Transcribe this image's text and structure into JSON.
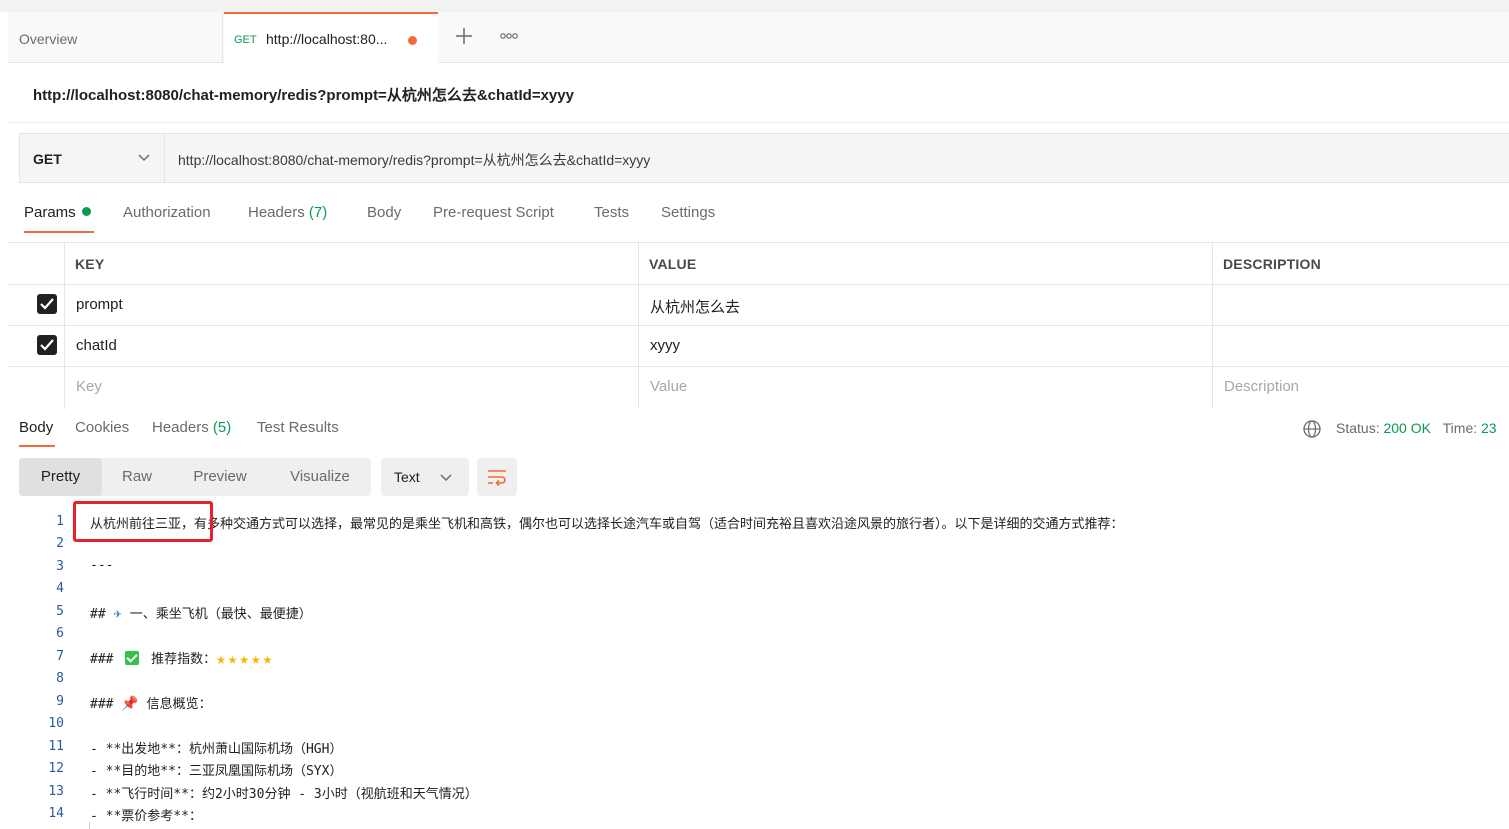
{
  "tabs": {
    "overview": "Overview",
    "request_method": "GET",
    "request_title": "http://localhost:80..."
  },
  "request": {
    "title": "http://localhost:8080/chat-memory/redis?prompt=从杭州怎么去&chatId=xyyy",
    "method": "GET",
    "url": "http://localhost:8080/chat-memory/redis?prompt=从杭州怎么去&chatId=xyyy"
  },
  "request_tabs": {
    "params": "Params",
    "authorization": "Authorization",
    "headers": "Headers",
    "headers_count": "(7)",
    "body": "Body",
    "prerequest": "Pre-request Script",
    "tests": "Tests",
    "settings": "Settings"
  },
  "params_table": {
    "headers": {
      "key": "KEY",
      "value": "VALUE",
      "description": "DESCRIPTION"
    },
    "rows": [
      {
        "key": "prompt",
        "value": "从杭州怎么去",
        "checked": true
      },
      {
        "key": "chatId",
        "value": "xyyy",
        "checked": true
      }
    ],
    "placeholders": {
      "key": "Key",
      "value": "Value",
      "description": "Description"
    }
  },
  "response_tabs": {
    "body": "Body",
    "cookies": "Cookies",
    "headers": "Headers",
    "headers_count": "(5)",
    "test_results": "Test Results"
  },
  "status": {
    "status_label": "Status:",
    "status_value": "200 OK",
    "time_label": "Time:",
    "time_value": "23"
  },
  "view_modes": {
    "pretty": "Pretty",
    "raw": "Raw",
    "preview": "Preview",
    "visualize": "Visualize"
  },
  "format": "Text",
  "code_lines": {
    "l1": "从杭州前往三亚，有多种交通方式可以选择，最常见的是乘坐飞机和高铁，偶尔也可以选择长途汽车或自驾（适合时间充裕且喜欢沿途风景的旅行者）。以下是详细的交通方式推荐：",
    "l3": "---",
    "l5_prefix": "##",
    "l5_text": "一、乘坐飞机（最快、最便捷）",
    "l7_prefix": "###",
    "l7_text": "推荐指数：",
    "l7_stars": "★★★★★",
    "l9_prefix": "###",
    "l9_text": "信息概览：",
    "l11": "- **出发地**：杭州萧山国际机场（HGH）",
    "l12": "- **目的地**：三亚凤凰国际机场（SYX）",
    "l13": "- **飞行时间**：约2小时30分钟 - 3小时（视航班和天气情况）",
    "l14": "- **票价参考**："
  },
  "line_numbers": [
    "1",
    "2",
    "3",
    "4",
    "5",
    "6",
    "7",
    "8",
    "9",
    "10",
    "11",
    "12",
    "13",
    "14"
  ],
  "colors": {
    "accent": "#f26b3a",
    "success": "#0c9a53",
    "highlight_box": "#e8202a"
  }
}
